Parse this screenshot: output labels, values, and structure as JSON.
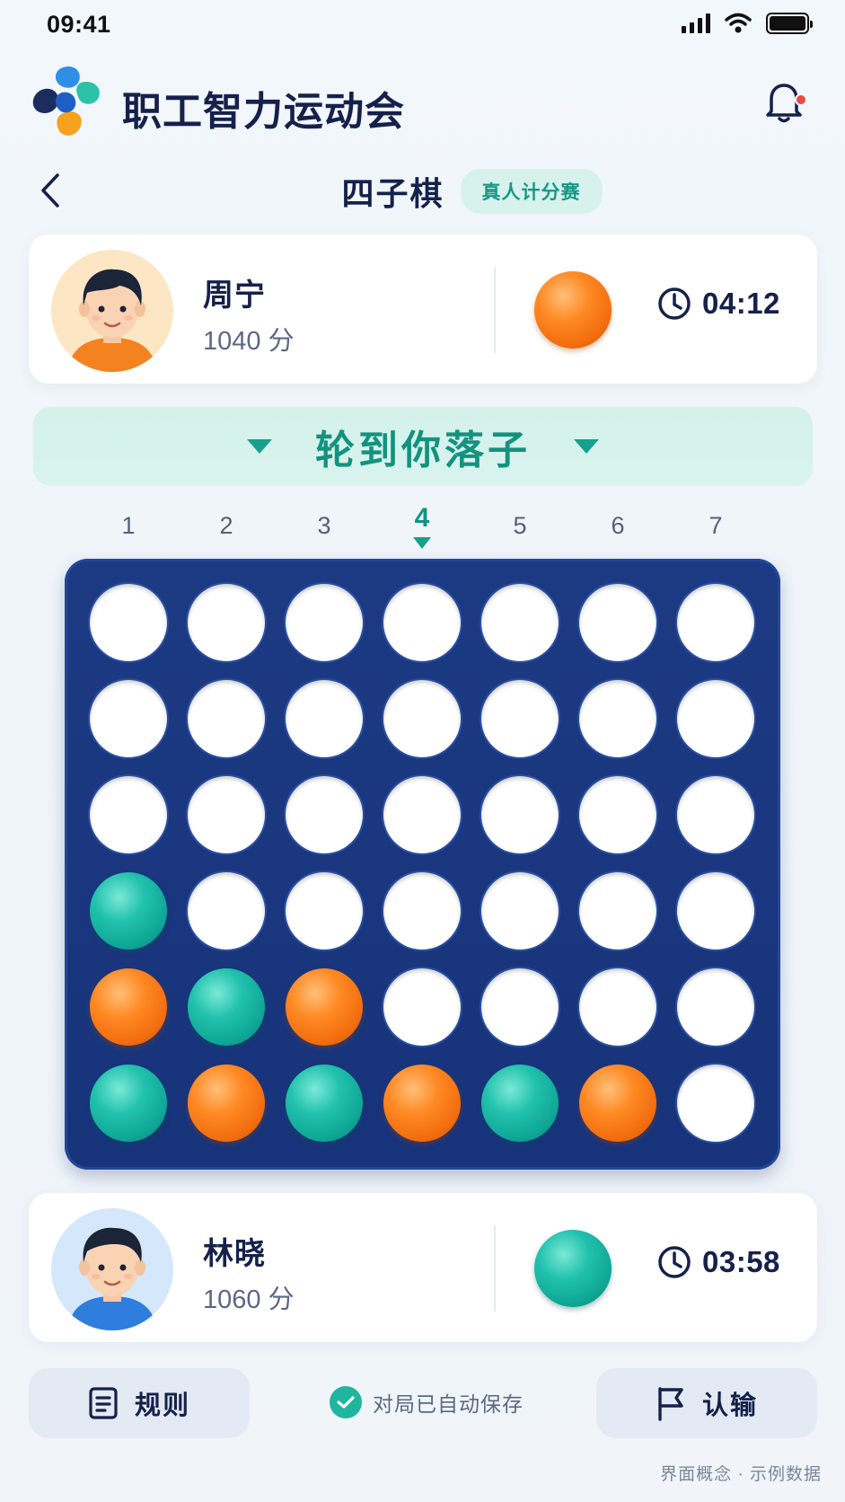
{
  "status_bar": {
    "time": "09:41"
  },
  "app": {
    "title": "职工智力运动会",
    "notification_dot": true
  },
  "game": {
    "title": "四子棋",
    "mode_badge": "真人计分赛"
  },
  "opponent": {
    "name": "周宁",
    "score": "1040 分",
    "disc_color": "orange",
    "timer": "04:12"
  },
  "turn_banner": {
    "text": "轮到你落子"
  },
  "columns": {
    "labels": [
      "1",
      "2",
      "3",
      "4",
      "5",
      "6",
      "7"
    ],
    "selected": "4"
  },
  "board": {
    "rows": 6,
    "cols": 7,
    "grid": [
      [
        "empty",
        "empty",
        "empty",
        "empty",
        "empty",
        "empty",
        "empty"
      ],
      [
        "empty",
        "empty",
        "empty",
        "empty",
        "empty",
        "empty",
        "empty"
      ],
      [
        "empty",
        "empty",
        "empty",
        "empty",
        "empty",
        "empty",
        "empty"
      ],
      [
        "teal",
        "empty",
        "empty",
        "empty",
        "empty",
        "empty",
        "empty"
      ],
      [
        "orange",
        "teal",
        "orange",
        "empty",
        "empty",
        "empty",
        "empty"
      ],
      [
        "teal",
        "orange",
        "teal",
        "orange",
        "teal",
        "orange",
        "empty"
      ]
    ]
  },
  "player": {
    "name": "林晓",
    "score": "1060 分",
    "disc_color": "teal",
    "timer": "03:58"
  },
  "bottom": {
    "rules_label": "规则",
    "save_status": "对局已自动保存",
    "resign_label": "认输"
  },
  "footnote": "界面概念 · 示例数据",
  "colors": {
    "accent": "#17a08d",
    "board": "#1c3a83",
    "orange": "#f26d0e",
    "teal": "#0fa696",
    "text_primary": "#15214b"
  }
}
